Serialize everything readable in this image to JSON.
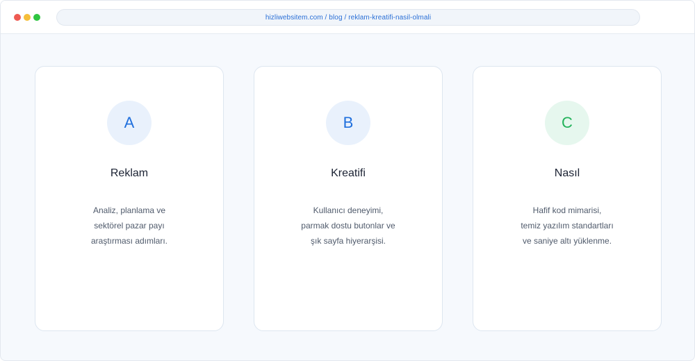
{
  "browser": {
    "url": "hizliwebsitem.com / blog / reklam-kreatifi-nasil-olmali"
  },
  "cards": [
    {
      "letter": "A",
      "title": "Reklam",
      "lines": [
        "Analiz, planlama ve",
        "sektörel pazar payı",
        "araştırması adımları."
      ]
    },
    {
      "letter": "B",
      "title": "Kreatifi",
      "lines": [
        "Kullanıcı deneyimi,",
        "parmak dostu butonlar ve",
        "şık sayfa hiyerarşisi."
      ]
    },
    {
      "letter": "C",
      "title": "Nasıl",
      "lines": [
        "Hafif kod mimarisi,",
        "temiz yazılım standartları",
        "ve saniye altı yüklenme."
      ]
    }
  ],
  "colors": {
    "accent_blue": "#1f6fdd",
    "accent_green": "#22b25a",
    "badge_blue_bg": "#e9f1fc",
    "badge_green_bg": "#e6f7ee"
  }
}
